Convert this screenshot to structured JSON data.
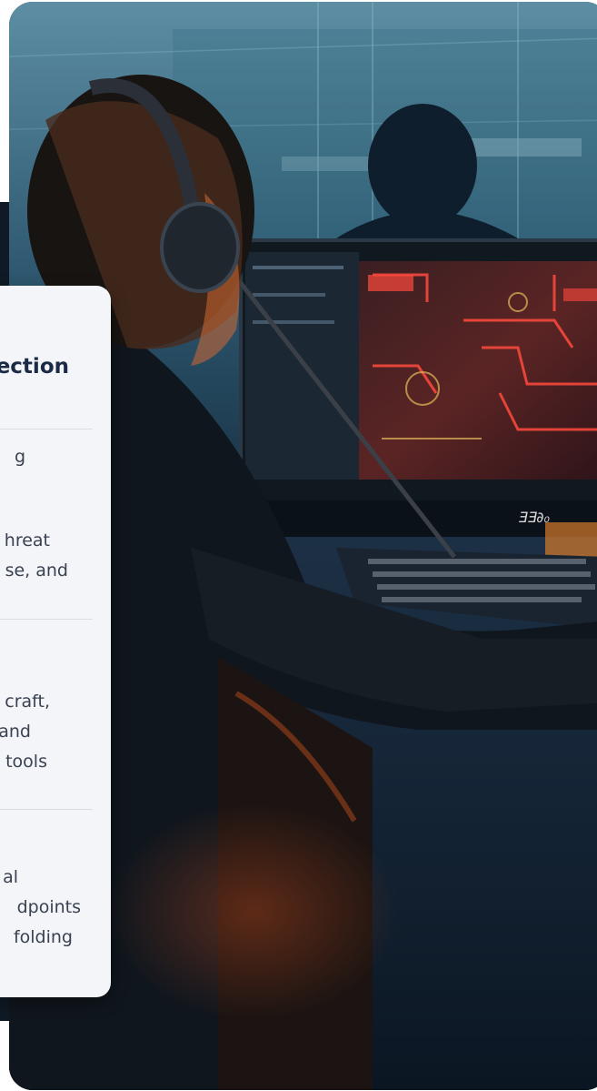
{
  "card": {
    "title": "ection",
    "sections": [
      {
        "lines": [
          "g",
          "hreat",
          "se, and"
        ]
      },
      {
        "lines": [
          "craft,",
          "and",
          "tools"
        ]
      },
      {
        "lines": [
          "al",
          "dpoints",
          "folding"
        ]
      }
    ]
  },
  "monitor": {
    "brand_text": "ƎƎ∂₀"
  }
}
